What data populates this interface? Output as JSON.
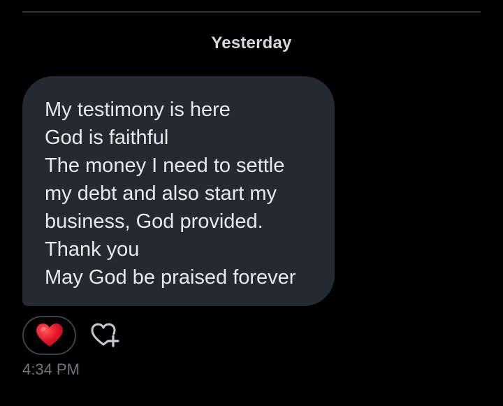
{
  "conversation": {
    "date_separator": "Yesterday",
    "message": {
      "lines": [
        "My testimony is here",
        "God is faithful",
        "The money I need to settle",
        "my debt and also start my",
        "business, God provided.",
        "Thank you",
        "May God be praised forever"
      ],
      "reaction": {
        "icon": "red-heart-icon",
        "color": "#e8192c"
      },
      "add_reaction_icon": "heart-plus-icon",
      "timestamp": "4:34 PM"
    }
  },
  "colors": {
    "background": "#000000",
    "bubble": "#232a31",
    "message_text": "#e7e9ea",
    "muted_text": "#71767b",
    "divider": "#2f3336"
  }
}
